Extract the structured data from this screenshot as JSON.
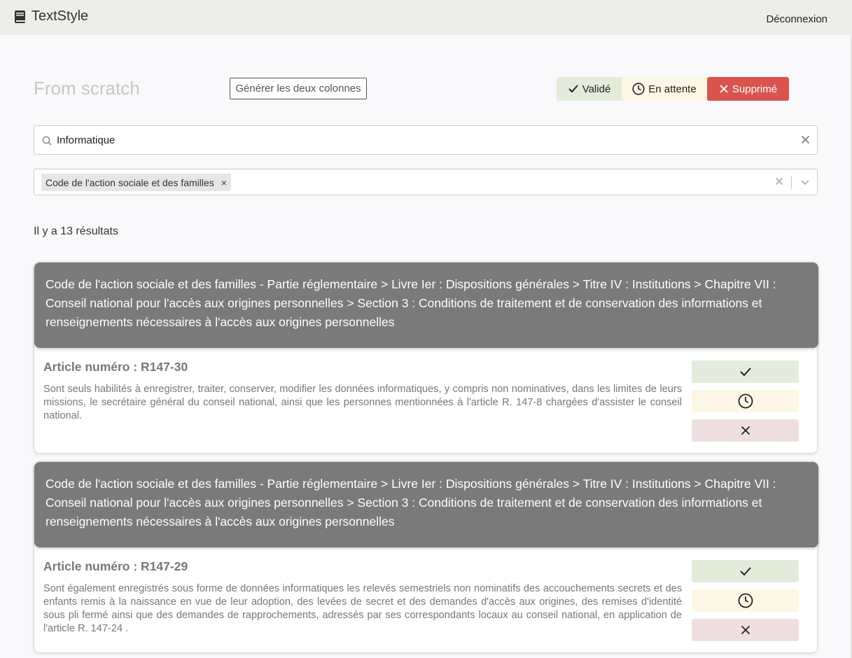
{
  "header": {
    "app_name": "TextStyle",
    "app_icon": "book-icon",
    "logout_label": "Déconnexion"
  },
  "toolbar": {
    "title": "From scratch",
    "generate_label": "Générer les deux colonnes",
    "filters": {
      "valid": {
        "label": "Validé",
        "icon": "check-icon",
        "color": "#e3ecdb"
      },
      "pending": {
        "label": "En attente",
        "icon": "clock-icon",
        "color": "#fcf6e4"
      },
      "deleted": {
        "label": "Supprimé",
        "icon": "close-icon",
        "color": "#d9534f"
      }
    }
  },
  "search": {
    "value": "Informatique"
  },
  "code_filter": {
    "selected": [
      "Code de l'action sociale et des familles"
    ]
  },
  "results": {
    "count_text": "Il y a 13 résultats",
    "items": [
      {
        "path": "Code de l'action sociale et des familles - Partie réglementaire > Livre Ier : Dispositions générales > Titre IV : Institutions > Chapitre VII : Conseil national pour l'accès aux origines personnelles > Section 3 : Conditions de traitement et de conservation des informations et renseignements nécessaires à l'accès aux origines personnelles",
        "article_title": "Article numéro : R147-30",
        "text": "Sont seuls habilités à enregistrer, traiter, conserver, modifier les données informatiques, y compris non nominatives, dans les limites de leurs missions, le secrétaire général du conseil national, ainsi que les personnes mentionnées à l'article R. 147-8 chargées d'assister le conseil national."
      },
      {
        "path": "Code de l'action sociale et des familles - Partie réglementaire > Livre Ier : Dispositions générales > Titre IV : Institutions > Chapitre VII : Conseil national pour l'accès aux origines personnelles > Section 3 : Conditions de traitement et de conservation des informations et renseignements nécessaires à l'accès aux origines personnelles",
        "article_title": "Article numéro : R147-29",
        "text": "Sont également enregistrés sous forme de données informatiques les relevés semestriels non nominatifs des accouchements secrets et des enfants remis à la naissance en vue de leur adoption, des levées de secret et des demandes d'accès aux origines, des remises d'identité sous pli fermé ainsi que des demandes de rapprochements, adressés par ses correspondants locaux au conseil national, en application de l'article R. 147-24 ."
      }
    ]
  }
}
